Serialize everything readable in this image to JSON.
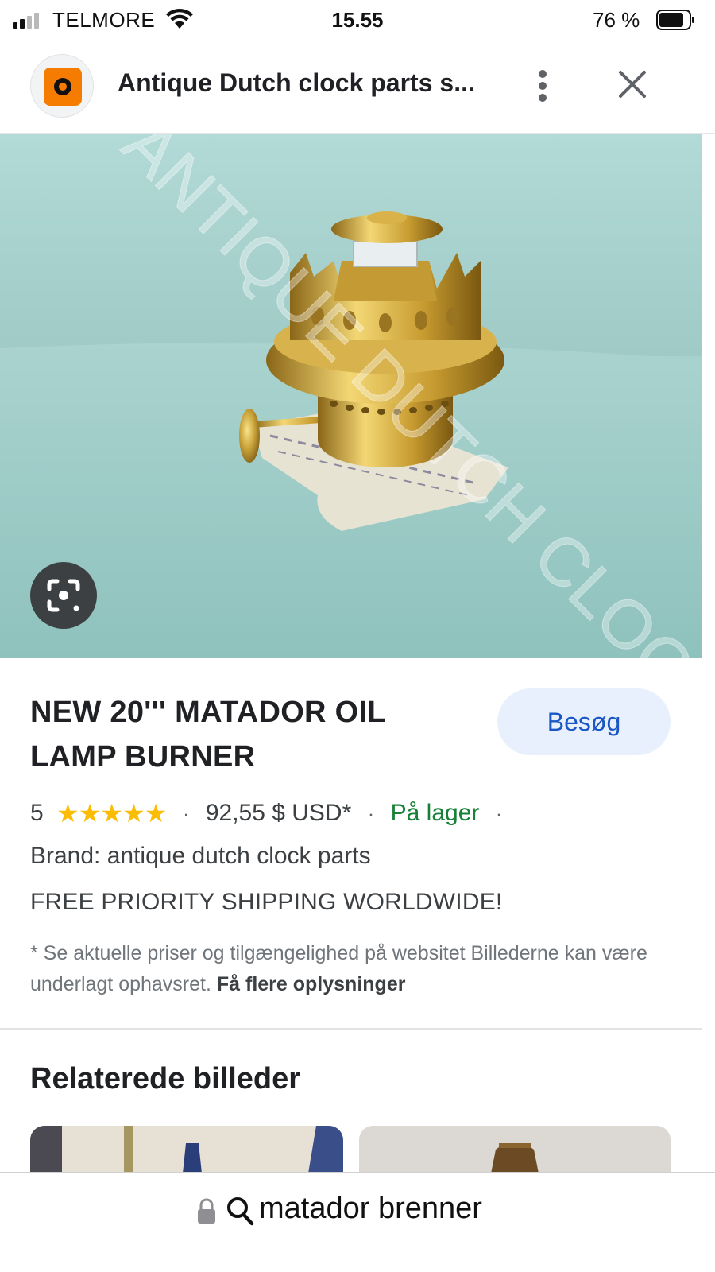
{
  "status_bar": {
    "carrier": "TELMORE",
    "time": "15.55",
    "battery": "76 %",
    "icons": [
      "signal-icon",
      "wifi-icon",
      "battery-icon"
    ]
  },
  "header": {
    "title": "Antique Dutch clock parts s...",
    "icons": [
      "site-logo-icon",
      "more-vert-icon",
      "close-icon"
    ]
  },
  "image": {
    "watermark": "ANTIQUE DUTCH CLOCK",
    "lens_icon": "google-lens-icon"
  },
  "product": {
    "title": "NEW 20''' MATADOR OIL LAMP BURNER",
    "visit_label": "Besøg",
    "rating": "5",
    "stars": "★★★★★",
    "rating_value": 5,
    "rating_max": 5,
    "separator": "·",
    "price": "92,55 $ USD*",
    "stock": "På lager",
    "brand": "Brand: antique dutch clock parts",
    "shipping": "FREE PRIORITY SHIPPING WORLDWIDE!",
    "disclaimer": "* Se aktuelle priser og tilgængelighed på websitet Billederne kan være underlagt ophavsret.",
    "more_info_link": "Få flere oplysninger"
  },
  "related": {
    "heading": "Relaterede billeder"
  },
  "url_bar": {
    "query": "matador brenner",
    "icons": [
      "lock-icon",
      "search-icon"
    ]
  },
  "colors": {
    "accent_blue": "#1a56c4",
    "visit_bg": "#e8f0fe",
    "stock_green": "#188038",
    "star_yellow": "#fbbc04"
  }
}
